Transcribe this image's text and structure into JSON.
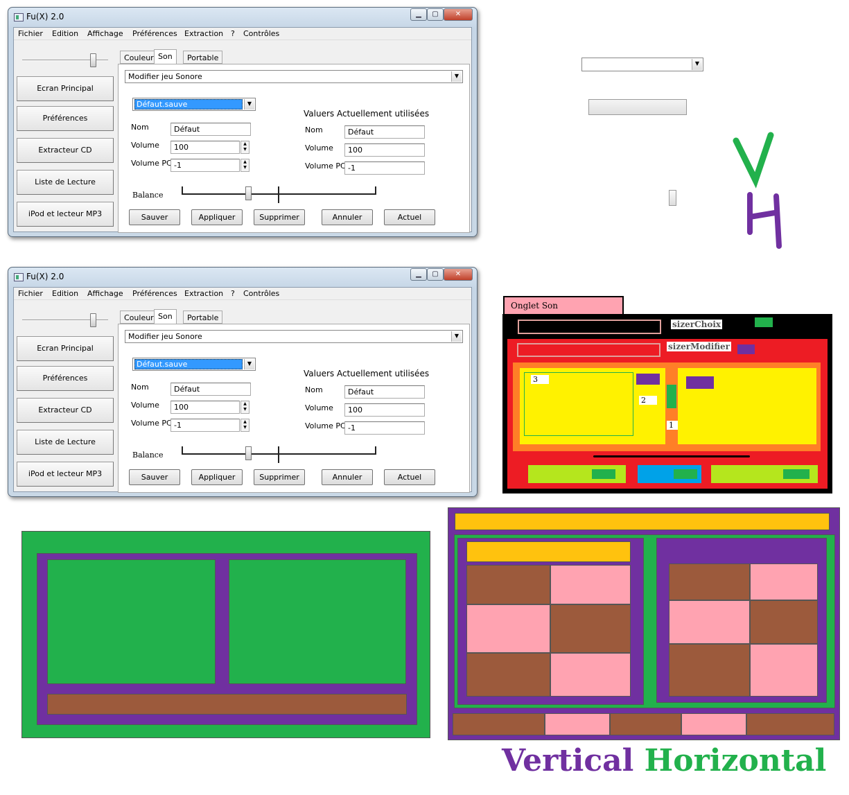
{
  "window": {
    "title": "Fu(X) 2.0",
    "controls": {
      "minimize": "▁",
      "maximize": "▢",
      "close": "✕"
    },
    "menu": [
      "Fichier",
      "Edition",
      "Affichage",
      "Préférences",
      "Extraction",
      "?",
      "Contrôles"
    ],
    "sidebar": [
      "Ecran Principal",
      "Préférences",
      "Extracteur CD",
      "Liste de Lecture",
      "iPod et lecteur MP3"
    ],
    "tabs": [
      "Couleur",
      "Son",
      "Portable"
    ],
    "selected_tab": "Son",
    "mode_combo": "Modifier jeu Sonore",
    "preset_combo": "Défaut.sauve",
    "left_form": {
      "nom_label": "Nom",
      "nom_value": "Défaut",
      "volume_label": "Volume",
      "volume_value": "100",
      "volume_pc_label": "Volume PC",
      "volume_pc_value": "-1"
    },
    "current_title": "Valuers Actuellement utilisées",
    "right_form": {
      "nom_label": "Nom",
      "nom_value": "Défaut",
      "volume_label": "Volume",
      "volume_value": "100",
      "volume_pc_label": "Volume PC",
      "volume_pc_value": "-1"
    },
    "balance_label": "Balance",
    "buttons": [
      "Sauver",
      "Appliquer",
      "Supprimer",
      "Annuler",
      "Actuel"
    ]
  },
  "sizer_diagram": {
    "tab_label": "Onglet Son",
    "sizer_choix": "sizerChoix",
    "sizer_modifier": "sizerModifier",
    "n3": "3",
    "n2": "2",
    "n1": "1"
  },
  "legend": {
    "vertical": "Vertical",
    "horizontal": "Horizontal",
    "v_letter": "V",
    "h_letter": "H"
  },
  "colors": {
    "vertical": "#7030a0",
    "horizontal": "#22b14c"
  }
}
